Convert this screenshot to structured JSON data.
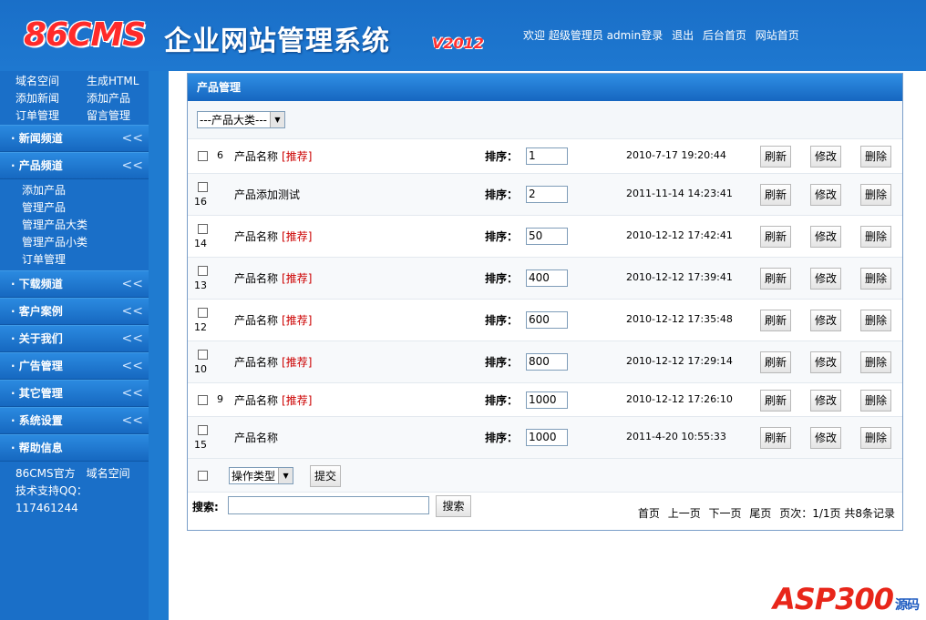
{
  "header": {
    "logo": "86CMS",
    "title": "企业网站管理系统",
    "version": "V2012",
    "links": [
      "欢迎 超级管理员 admin登录",
      "退出",
      "后台首页",
      "网站首页"
    ]
  },
  "sidebar": {
    "quick_links": [
      "域名空间",
      "生成HTML",
      "添加新闻",
      "添加产品",
      "订单管理",
      "留言管理"
    ],
    "sections": [
      {
        "label": "新闻频道",
        "arrow": "<<"
      },
      {
        "label": "产品频道",
        "arrow": "<<"
      },
      {
        "label": "下载频道",
        "arrow": "<<"
      },
      {
        "label": "客户案例",
        "arrow": "<<"
      },
      {
        "label": "关于我们",
        "arrow": "<<"
      },
      {
        "label": "广告管理",
        "arrow": "<<"
      },
      {
        "label": "其它管理",
        "arrow": "<<"
      },
      {
        "label": "系统设置",
        "arrow": "<<"
      },
      {
        "label": "帮助信息",
        "arrow": ""
      }
    ],
    "product_items": [
      "添加产品",
      "管理产品",
      "管理产品大类",
      "管理产品小类",
      "订单管理"
    ],
    "footer": {
      "official": "86CMS官方",
      "domain": "域名空间",
      "support": "技术支持QQ：117461244"
    }
  },
  "panel": {
    "title": "产品管理",
    "category_select": "---产品大类---",
    "sort_label": "排序：",
    "buttons": {
      "refresh": "刷新",
      "edit": "修改",
      "delete": "删除"
    },
    "rows": [
      {
        "id": "6",
        "name": "产品名称",
        "tag": "[推荐]",
        "sort": "1",
        "date": "2010-7-17 19:20:44"
      },
      {
        "id": "16",
        "name": "产品添加测试",
        "tag": "",
        "sort": "2",
        "date": "2011-11-14 14:23:41"
      },
      {
        "id": "14",
        "name": "产品名称",
        "tag": "[推荐]",
        "sort": "50",
        "date": "2010-12-12 17:42:41"
      },
      {
        "id": "13",
        "name": "产品名称",
        "tag": "[推荐]",
        "sort": "400",
        "date": "2010-12-12 17:39:41"
      },
      {
        "id": "12",
        "name": "产品名称",
        "tag": "[推荐]",
        "sort": "600",
        "date": "2010-12-12 17:35:48"
      },
      {
        "id": "10",
        "name": "产品名称",
        "tag": "[推荐]",
        "sort": "800",
        "date": "2010-12-12 17:29:14"
      },
      {
        "id": "9",
        "name": "产品名称",
        "tag": "[推荐]",
        "sort": "1000",
        "date": "2010-12-12 17:26:10"
      },
      {
        "id": "15",
        "name": "产品名称",
        "tag": "",
        "sort": "1000",
        "date": "2011-4-20 10:55:33"
      }
    ],
    "op_select": "操作类型",
    "submit": "提交",
    "search_label": "搜索:",
    "search_button": "搜索",
    "pager": {
      "first": "首页",
      "prev": "上一页",
      "next": "下一页",
      "last": "尾页",
      "info": "页次：1/1页 共8条记录"
    }
  },
  "watermark": {
    "main": "ASP300",
    "tail": "源码"
  }
}
